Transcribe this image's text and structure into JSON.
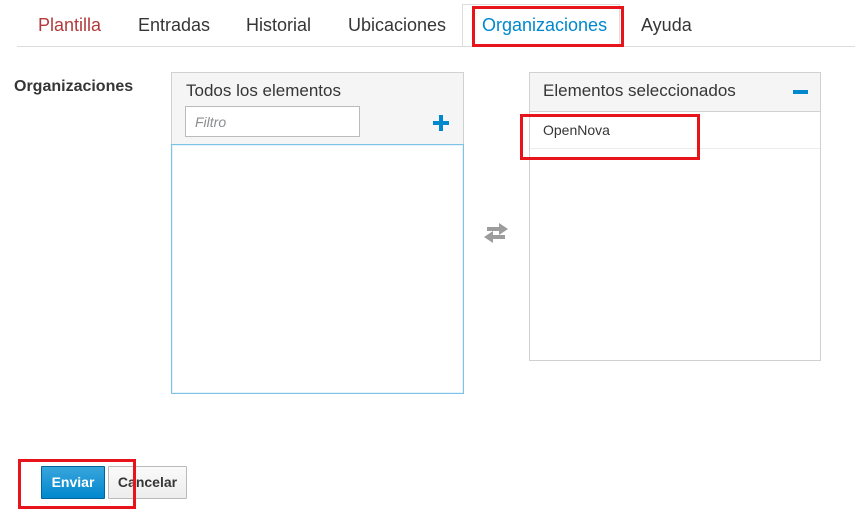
{
  "tabs": [
    {
      "label": "Plantilla"
    },
    {
      "label": "Entradas"
    },
    {
      "label": "Historial"
    },
    {
      "label": "Ubicaciones"
    },
    {
      "label": "Organizaciones"
    },
    {
      "label": "Ayuda"
    }
  ],
  "field": {
    "label": "Organizaciones"
  },
  "all_items": {
    "title": "Todos los elementos",
    "filter_placeholder": "Filtro",
    "filter_value": "",
    "items": []
  },
  "selected_items": {
    "title": "Elementos seleccionados",
    "items": [
      {
        "label": "OpenNova"
      }
    ]
  },
  "buttons": {
    "submit_label": "Enviar",
    "cancel_label": "Cancelar"
  },
  "colors": {
    "accent": "#0088ce",
    "highlight": "#e8141c",
    "first_tab": "#b33a3a"
  },
  "icons": {
    "add": "plus-icon",
    "remove": "minus-icon",
    "transfer": "transfer-arrows-icon"
  }
}
